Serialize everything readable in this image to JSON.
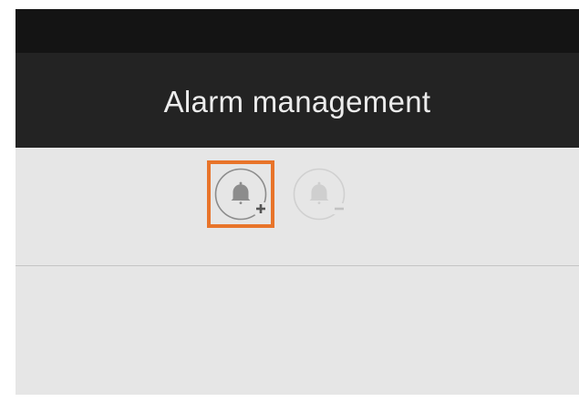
{
  "header": {
    "title": "Alarm management"
  },
  "toolbar": {
    "buttons": [
      {
        "name": "add-alarm",
        "icon": "bell-plus-icon",
        "enabled": true,
        "highlighted": true
      },
      {
        "name": "remove-alarm",
        "icon": "bell-minus-icon",
        "enabled": false,
        "highlighted": false
      }
    ]
  },
  "colors": {
    "status_strip": "#141414",
    "header_background": "#232323",
    "title_text": "#ececec",
    "body_background": "#e6e6e6",
    "highlight_border": "#e8742a",
    "icon_enabled": "#8c8c8c",
    "icon_disabled": "#cfcfcf"
  }
}
